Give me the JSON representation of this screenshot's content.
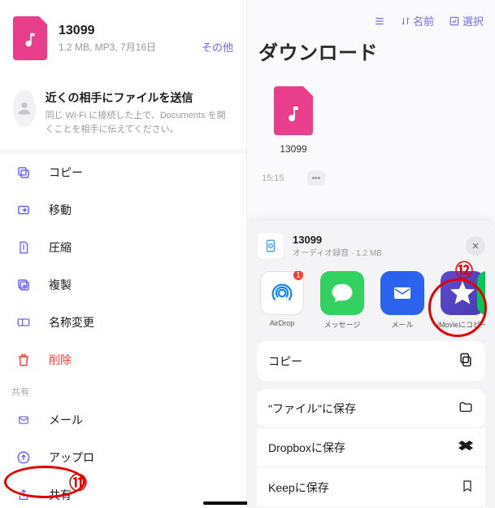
{
  "left": {
    "file": {
      "title": "13099",
      "meta": "1.2 MB, MP3, 7月16日",
      "other": "その他"
    },
    "nearby": {
      "title": "近くの相手にファイルを送信",
      "desc": "同じ Wi-Fi に接続した上で、Documents を開くことを相手に伝えてください。"
    },
    "menu": {
      "copy": "コピー",
      "move": "移動",
      "compress": "圧縮",
      "duplicate": "複製",
      "rename": "名称変更",
      "delete": "削除"
    },
    "sectionShare": "共有",
    "share": {
      "mail": "メール",
      "upload": "アップロ",
      "share": "共有"
    }
  },
  "right": {
    "top": {
      "list": "",
      "sort": "名前",
      "select": "選択"
    },
    "title": "ダウンロード",
    "card": {
      "name": "13099",
      "time": "15:15"
    },
    "sheet": {
      "title": "13099",
      "subtitle": "オーディオ録音 · 1.2 MB",
      "apps": {
        "airdrop": "AirDrop",
        "message": "メッセージ",
        "mail": "メール",
        "imovie": "iMovieにコピー"
      },
      "badge": "1",
      "opts": {
        "copy": "コピー",
        "saveFiles": "\"ファイル\"に保存",
        "dropbox": "Dropboxに保存",
        "keep": "Keepに保存"
      }
    }
  },
  "annotations": {
    "n11": "⑪",
    "n12": "⑫"
  }
}
